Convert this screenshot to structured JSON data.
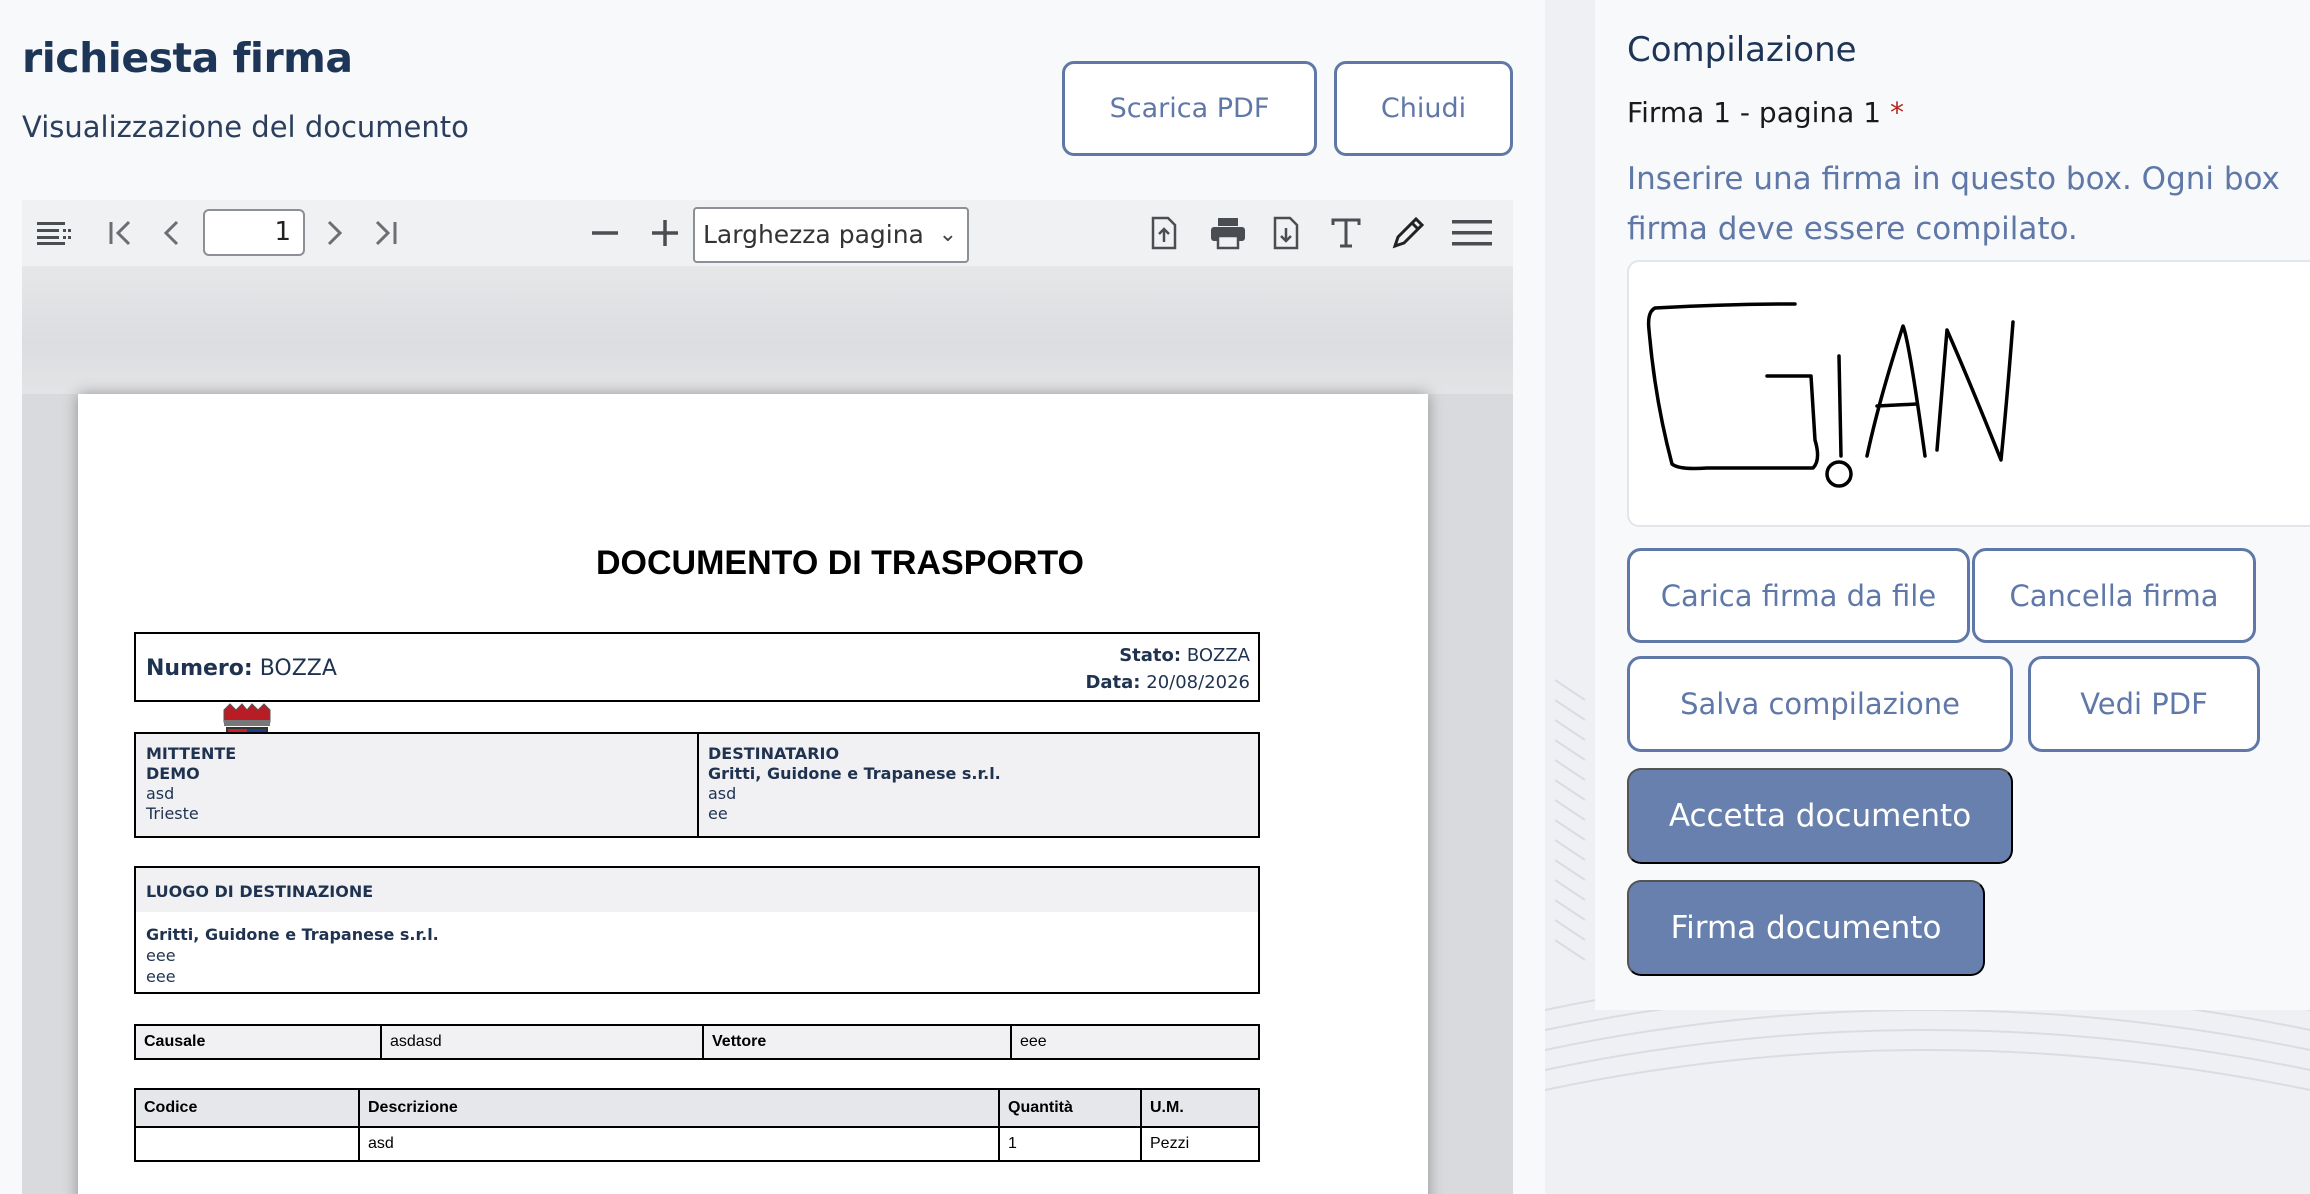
{
  "header": {
    "title": "richiesta firma",
    "subtitle": "Visualizzazione del documento",
    "download_label": "Scarica PDF",
    "close_label": "Chiudi"
  },
  "viewer": {
    "page_number": "1",
    "zoom_label": "Larghezza pagina",
    "toolbar_icons": [
      "sidebar-toggle-icon",
      "first-page-icon",
      "previous-page-icon",
      "next-page-icon",
      "last-page-icon",
      "zoom-out-icon",
      "zoom-in-icon",
      "open-file-icon",
      "print-icon",
      "download-icon",
      "text-tool-icon",
      "draw-tool-icon",
      "menu-icon"
    ]
  },
  "document": {
    "title": "DOCUMENTO DI TRASPORTO",
    "numero_label": "Numero:",
    "numero_value": "BOZZA",
    "stato_label": "Stato:",
    "stato_value": "BOZZA",
    "data_label": "Data:",
    "data_value": "20/08/2026",
    "mittente": {
      "heading": "MITTENTE",
      "name": "DEMO",
      "line1": "asd",
      "line2": "Trieste"
    },
    "destinatario": {
      "heading": "DESTINATARIO",
      "name": "Gritti, Guidone e Trapanese s.r.l.",
      "line1": "asd",
      "line2": "ee"
    },
    "luogo": {
      "heading": "LUOGO DI DESTINAZIONE",
      "name": "Gritti, Guidone e Trapanese s.r.l.",
      "line1": "eee",
      "line2": "eee"
    },
    "causale": {
      "causale_label": "Causale",
      "causale_value": "asdasd",
      "vettore_label": "Vettore",
      "vettore_value": "eee"
    },
    "items": {
      "headers": [
        "Codice",
        "Descrizione",
        "Quantità",
        "U.M."
      ],
      "rows": [
        [
          "",
          "asd",
          "1",
          "Pezzi"
        ]
      ]
    }
  },
  "compilation": {
    "title": "Compilazione",
    "field_label": "Firma 1 - pagina 1",
    "required_mark": "*",
    "hint": "Inserire una firma in questo box. Ogni box firma deve essere compilato.",
    "upload_label": "Carica firma da file",
    "clear_label": "Cancella firma",
    "save_label": "Salva compilazione",
    "view_pdf_label": "Vedi PDF",
    "accept_label": "Accetta documento",
    "sign_label": "Firma documento"
  },
  "colors": {
    "accent": "#5f78a8",
    "accent_fill": "#6780ad",
    "title": "#1d3557",
    "required": "#b3261e"
  }
}
